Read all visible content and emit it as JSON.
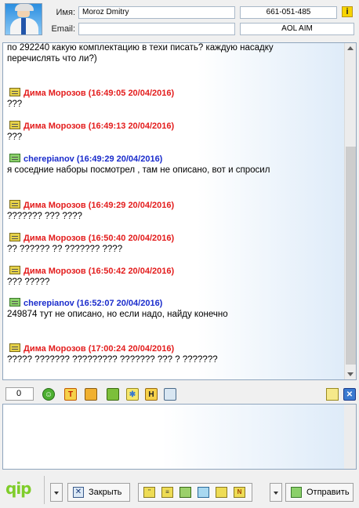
{
  "header": {
    "name_label": "Имя:",
    "name_value": "Moroz  Dmitry",
    "phone_value": "661-051-485",
    "email_label": "Email:",
    "email_value": "",
    "protocol_value": "AOL AIM",
    "info_icon_glyph": "i"
  },
  "log": {
    "messages": [
      {
        "author": "",
        "timestamp": "",
        "text_lines": [
          "по 292240 какую комплектацию в техи писать? каждую насадку",
          "перечислять что ли?)"
        ]
      },
      {
        "author": "Дима Морозов",
        "timestamp": "(16:49:05 20/04/2016)",
        "sender": "them",
        "text_lines": [
          "???"
        ]
      },
      {
        "author": "Дима Морозов",
        "timestamp": "(16:49:13 20/04/2016)",
        "sender": "them",
        "text_lines": [
          "???"
        ]
      },
      {
        "author": "cherepianov",
        "timestamp": "(16:49:29 20/04/2016)",
        "sender": "me",
        "text_lines": [
          "я соседние наборы посмотрел , там не описано, вот и спросил"
        ]
      },
      {
        "author": "Дима Морозов",
        "timestamp": "(16:49:29 20/04/2016)",
        "sender": "them",
        "text_lines": [
          "??????? ??? ????"
        ]
      },
      {
        "author": "Дима Морозов",
        "timestamp": "(16:50:40 20/04/2016)",
        "sender": "them",
        "text_lines": [
          "?? ?????? ?? ??????? ????"
        ]
      },
      {
        "author": "Дима Морозов",
        "timestamp": "(16:50:42 20/04/2016)",
        "sender": "them",
        "text_lines": [
          "??? ?????"
        ]
      },
      {
        "author": "cherepianov",
        "timestamp": "(16:52:07 20/04/2016)",
        "sender": "me",
        "text_lines": [
          "249874 тут не описано, но если надо, найду конечно"
        ]
      },
      {
        "author": "Дима Морозов",
        "timestamp": "(17:00:24 20/04/2016)",
        "sender": "them",
        "text_lines": [
          "????? ??????? ????????? ??????? ??? ? ???????"
        ]
      }
    ]
  },
  "toolbar": {
    "counter_value": "0",
    "icons": [
      "smiley-icon",
      "font-icon",
      "color-fill-icon",
      "save-icon",
      "snowflake-icon",
      "history-icon",
      "image-icon"
    ],
    "font_glyph": "T",
    "history_glyph": "H"
  },
  "bottom": {
    "logo_text": "qip",
    "logo_sub": "",
    "close_label": "Закрыть",
    "send_label": "Отправить",
    "quick_icons": [
      "quote-icon",
      "list-icon",
      "contact-card-icon",
      "transfer-icon",
      "send-file-icon",
      "notes-icon"
    ],
    "notes_glyph": "N"
  }
}
